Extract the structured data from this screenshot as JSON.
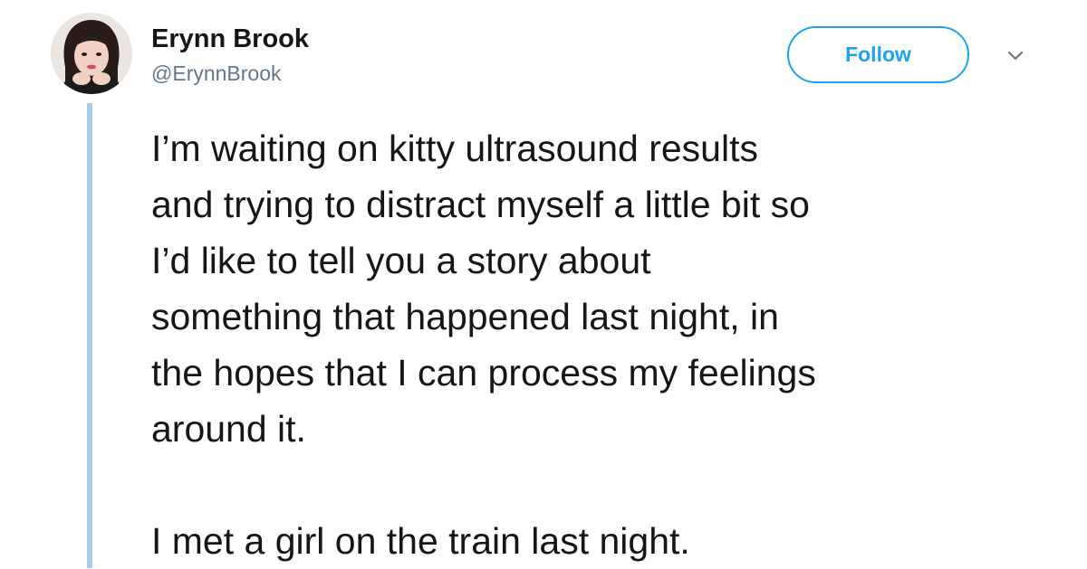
{
  "author": {
    "display_name": "Erynn Brook",
    "handle": "@ErynnBrook"
  },
  "actions": {
    "follow_label": "Follow",
    "more_icon": "chevron-down-icon"
  },
  "tweet": {
    "paragraph_1": "I’m waiting on kitty ultrasound results\nand trying to distract myself a little bit so\nI’d like to tell you a story about\nsomething that happened last night, in\nthe hopes that I can process my feelings\naround it.",
    "paragraph_2": "I met a girl on the train last night."
  },
  "colors": {
    "accent": "#1da1f2",
    "thread_line": "#a7cbe8",
    "text": "#14171a",
    "secondary_text": "#657786"
  }
}
